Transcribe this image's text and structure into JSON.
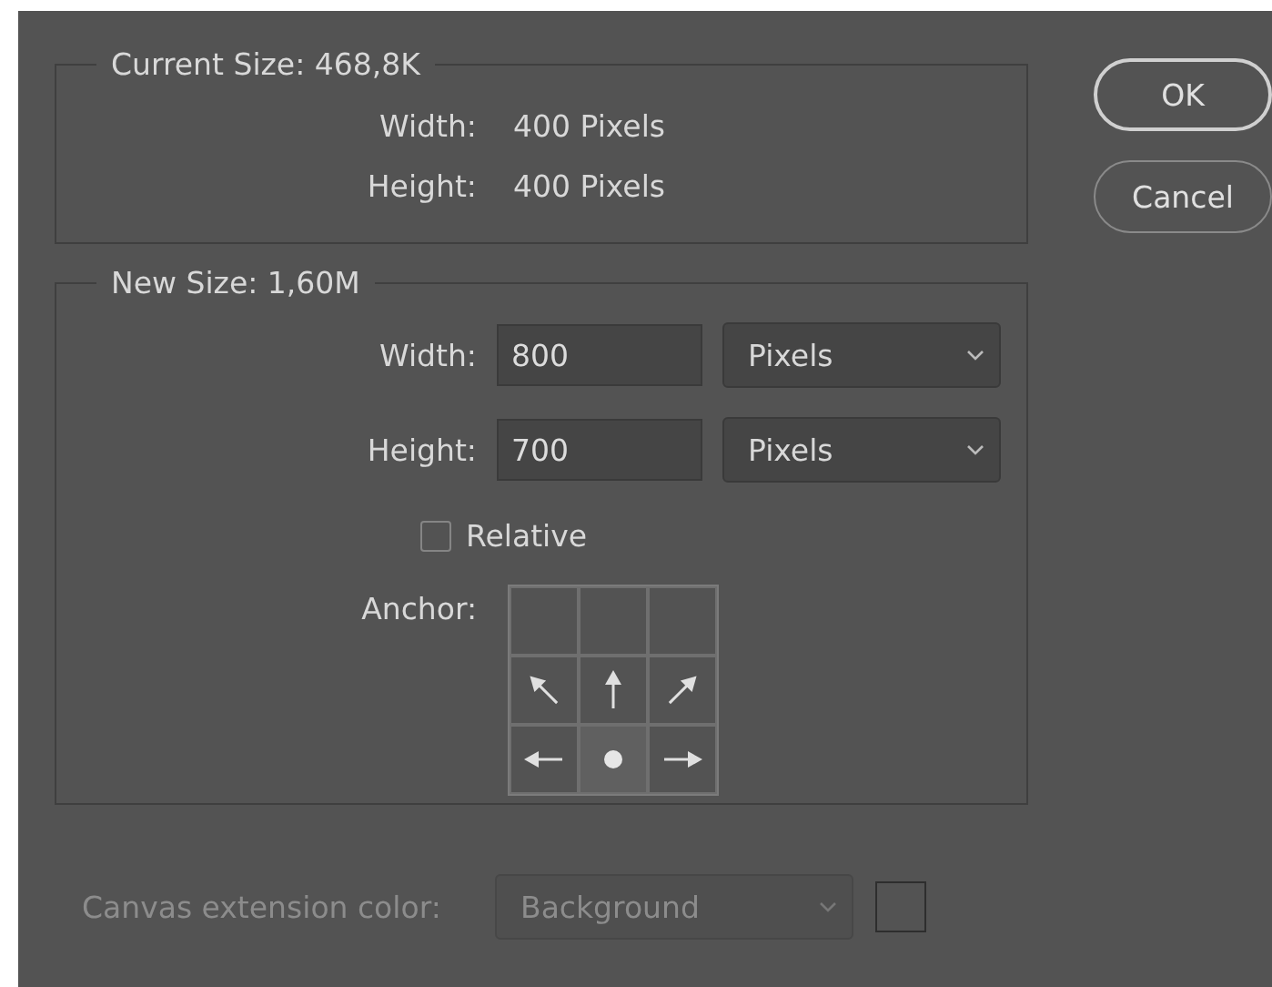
{
  "current_size": {
    "title": "Current Size: 468,8K",
    "rows": [
      {
        "label": "Width:",
        "value": "400 Pixels"
      },
      {
        "label": "Height:",
        "value": "400 Pixels"
      }
    ]
  },
  "new_size": {
    "title": "New Size: 1,60M",
    "fields": [
      {
        "label": "Width:",
        "value": "800",
        "unit": "Pixels"
      },
      {
        "label": "Height:",
        "value": "700",
        "unit": "Pixels"
      }
    ],
    "relative": {
      "label": "Relative",
      "checked": false
    },
    "anchor": {
      "label": "Anchor:",
      "cells": [
        {
          "selected": false
        },
        {
          "selected": false
        },
        {
          "selected": false
        },
        {
          "selected": false
        },
        {
          "selected": false
        },
        {
          "selected": false
        },
        {
          "selected": false
        },
        {
          "selected": true
        },
        {
          "selected": false
        }
      ]
    }
  },
  "canvas_extension": {
    "label": "Canvas extension color:",
    "value": "Background",
    "disabled": true
  },
  "buttons": [
    {
      "label": "OK",
      "default": true
    },
    {
      "label": "Cancel",
      "default": false
    }
  ]
}
